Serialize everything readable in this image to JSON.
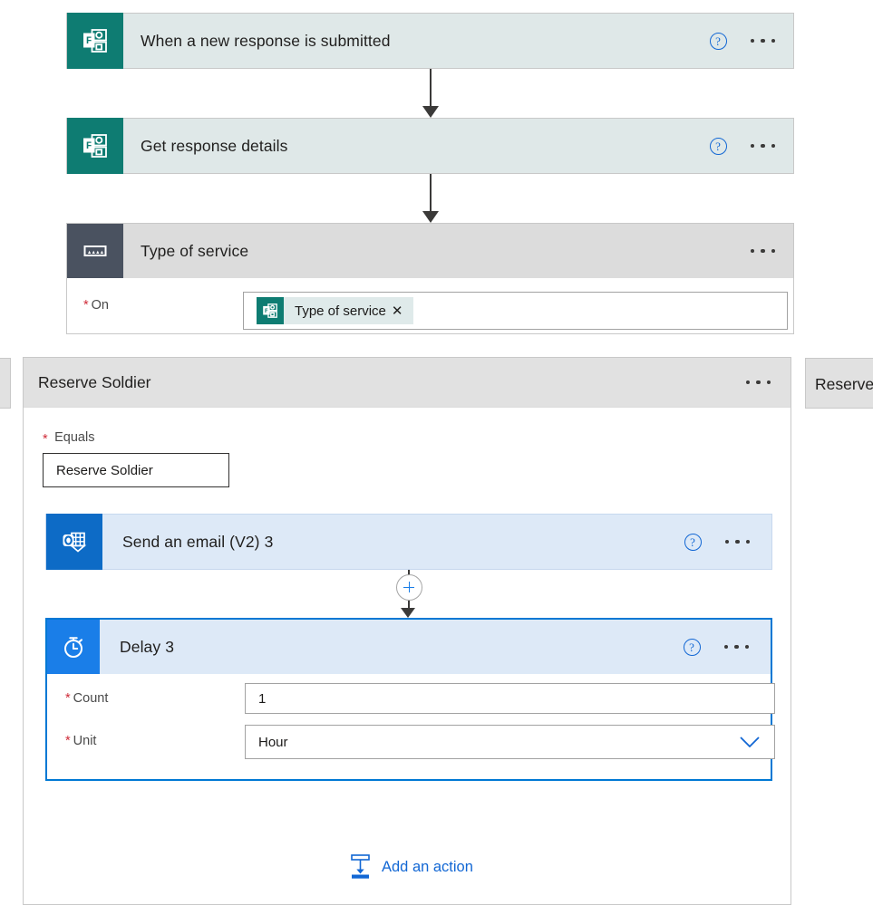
{
  "flow": {
    "trigger": {
      "title": "When a new response is submitted",
      "icon": "microsoft-forms-icon",
      "help_label": "?",
      "menu_label": "…"
    },
    "steps": [
      {
        "title": "Get response details",
        "icon": "microsoft-forms-icon"
      }
    ],
    "switch": {
      "title": "Type of service",
      "icon": "switch-control-icon",
      "on_field": {
        "label": "On",
        "required_marker": "*",
        "token": {
          "text": "Type of service",
          "icon": "microsoft-forms-icon",
          "remove_label": "✕"
        }
      }
    },
    "cases": [
      {
        "title": "Reserve Soldier",
        "equals": {
          "label": "Equals",
          "required_marker": "*",
          "value": "Reserve Soldier"
        },
        "actions": [
          {
            "title": "Send an email (V2) 3",
            "icon": "outlook-icon"
          },
          {
            "title": "Delay 3",
            "icon": "delay-stopwatch-icon",
            "selected": true,
            "params": [
              {
                "label": "Count",
                "required_marker": "*",
                "value": "1",
                "type": "text"
              },
              {
                "label": "Unit",
                "required_marker": "*",
                "value": "Hour",
                "type": "dropdown"
              }
            ]
          }
        ],
        "add_action": {
          "label": "Add an action",
          "icon": "insert-action-icon"
        }
      }
    ],
    "adjacent_case_right": {
      "title": "Reserve"
    }
  },
  "colors": {
    "forms_teal": "#0e7c72",
    "switch_slate": "#4a5260",
    "outlook_blue": "#0d6bc6",
    "delay_blue": "#1a7ee8",
    "selection_blue": "#0078d4",
    "link_blue": "#1267d4",
    "required_red": "#cf2b38",
    "card_grey": "#e1e1e1",
    "card_light_blue": "#dde9f7",
    "card_trigger_grey": "#dfe8e8"
  }
}
